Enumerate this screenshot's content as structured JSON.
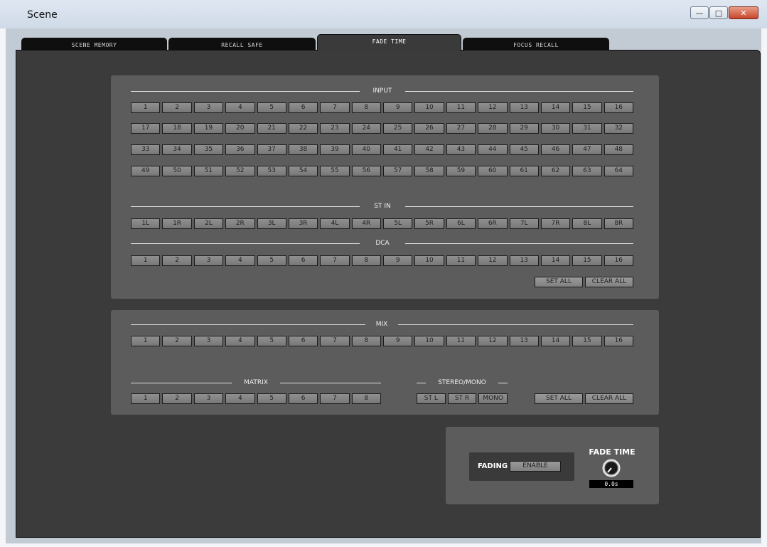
{
  "window": {
    "title": "Scene",
    "minimize": "—",
    "maximize": "□",
    "close": "✕"
  },
  "tabs": [
    {
      "label": "SCENE MEMORY",
      "active": false
    },
    {
      "label": "RECALL SAFE",
      "active": false
    },
    {
      "label": "FADE TIME",
      "active": true
    },
    {
      "label": "FOCUS RECALL",
      "active": false
    }
  ],
  "input": {
    "label": "INPUT",
    "rows": [
      [
        "1",
        "2",
        "3",
        "4",
        "5",
        "6",
        "7",
        "8",
        "9",
        "10",
        "11",
        "12",
        "13",
        "14",
        "15",
        "16"
      ],
      [
        "17",
        "18",
        "19",
        "20",
        "21",
        "22",
        "23",
        "24",
        "25",
        "26",
        "27",
        "28",
        "29",
        "30",
        "31",
        "32"
      ],
      [
        "33",
        "34",
        "35",
        "36",
        "37",
        "38",
        "39",
        "40",
        "41",
        "42",
        "43",
        "44",
        "45",
        "46",
        "47",
        "48"
      ],
      [
        "49",
        "50",
        "51",
        "52",
        "53",
        "54",
        "55",
        "56",
        "57",
        "58",
        "59",
        "60",
        "61",
        "62",
        "63",
        "64"
      ]
    ]
  },
  "st_in": {
    "label": "ST IN",
    "buttons": [
      "1L",
      "1R",
      "2L",
      "2R",
      "3L",
      "3R",
      "4L",
      "4R",
      "5L",
      "5R",
      "6L",
      "6R",
      "7L",
      "7R",
      "8L",
      "8R"
    ]
  },
  "dca": {
    "label": "DCA",
    "buttons": [
      "1",
      "2",
      "3",
      "4",
      "5",
      "6",
      "7",
      "8",
      "9",
      "10",
      "11",
      "12",
      "13",
      "14",
      "15",
      "16"
    ]
  },
  "panel1_actions": {
    "set_all": "SET ALL",
    "clear_all": "CLEAR ALL"
  },
  "mix": {
    "label": "MIX",
    "buttons": [
      "1",
      "2",
      "3",
      "4",
      "5",
      "6",
      "7",
      "8",
      "9",
      "10",
      "11",
      "12",
      "13",
      "14",
      "15",
      "16"
    ]
  },
  "matrix": {
    "label": "MATRIX",
    "buttons": [
      "1",
      "2",
      "3",
      "4",
      "5",
      "6",
      "7",
      "8"
    ]
  },
  "stereo_mono": {
    "label": "STEREO/MONO",
    "buttons": [
      "ST L",
      "ST R",
      "MONO"
    ]
  },
  "panel2_actions": {
    "set_all": "SET ALL",
    "clear_all": "CLEAR ALL"
  },
  "fade": {
    "fading_label": "FADING",
    "enable_label": "ENABLE",
    "fade_time_label": "FADE TIME",
    "fade_time_value": "0.0s"
  }
}
